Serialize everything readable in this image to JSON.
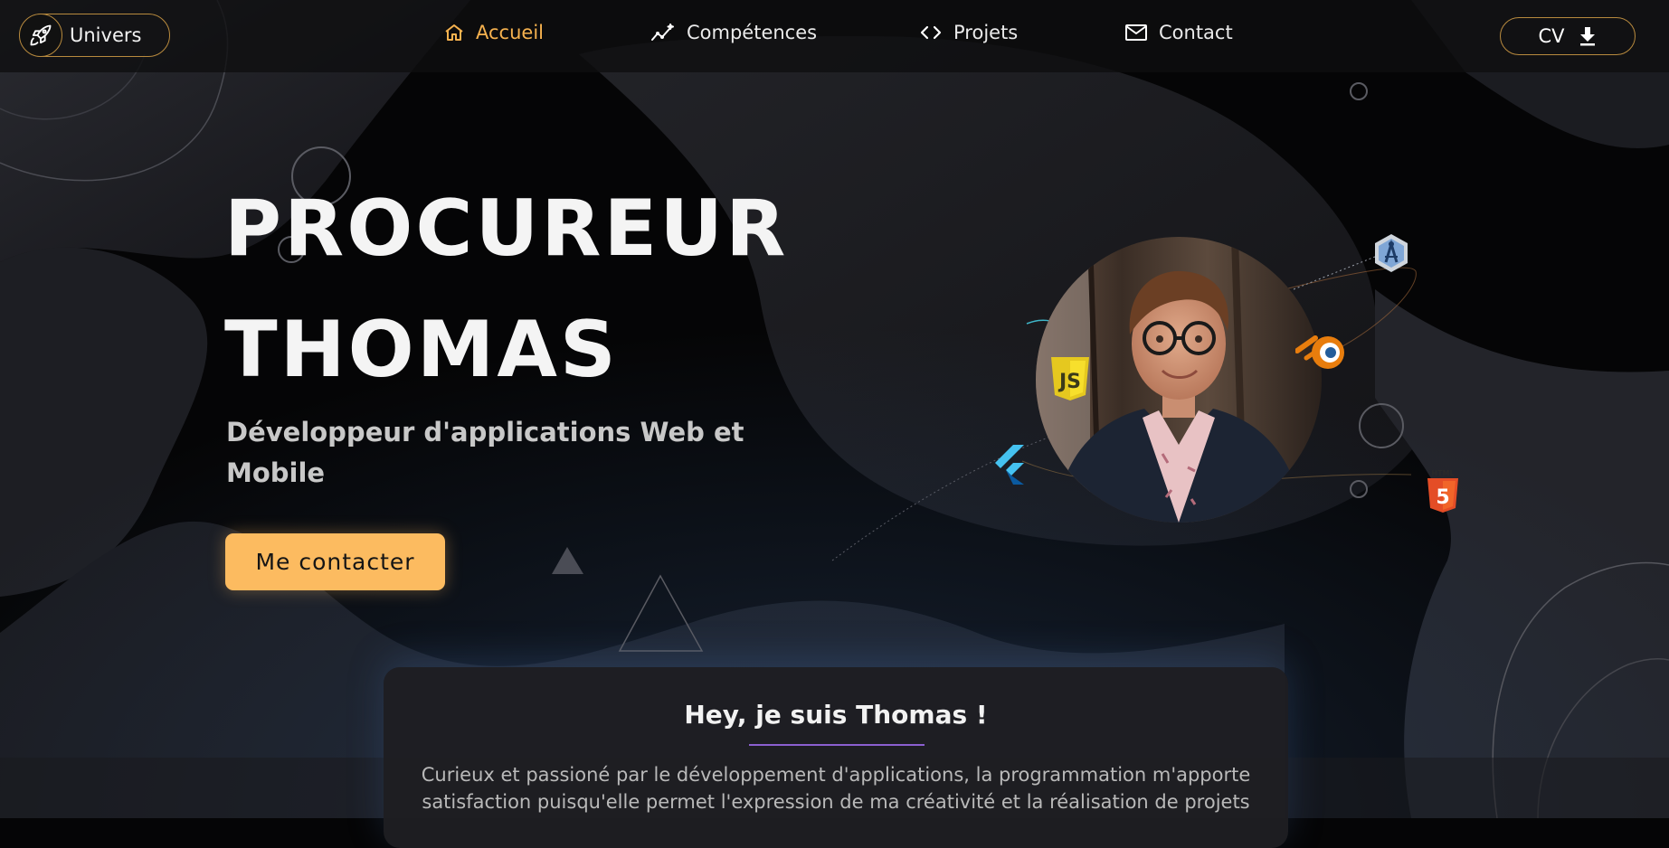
{
  "navbar": {
    "univers_label": "Univers",
    "items": [
      {
        "label": "Accueil",
        "icon": "home-icon",
        "active": true
      },
      {
        "label": "Compétences",
        "icon": "skills-chart-icon",
        "active": false
      },
      {
        "label": "Projets",
        "icon": "code-icon",
        "active": false
      },
      {
        "label": "Contact",
        "icon": "mail-icon",
        "active": false
      }
    ],
    "cv_label": "CV"
  },
  "hero": {
    "name_line1": "PROCUREUR",
    "name_line2": "THOMAS",
    "subtitle": "Développeur d'applications Web et Mobile",
    "cta_label": "Me contacter"
  },
  "tech_icons": [
    "android-studio-icon",
    "blender-icon",
    "javascript-icon",
    "flutter-icon",
    "html5-icon"
  ],
  "about": {
    "title": "Hey, je suis Thomas !",
    "text": "Curieux et passioné par le développement d'applications, la programmation m'apporte satisfaction puisqu'elle permet l'expression de ma créativité et la réalisation de projets"
  },
  "colors": {
    "accent": "#fcbb60",
    "active_nav": "#f6b24f",
    "underline": "#8b5fd0",
    "background": "#050506"
  }
}
